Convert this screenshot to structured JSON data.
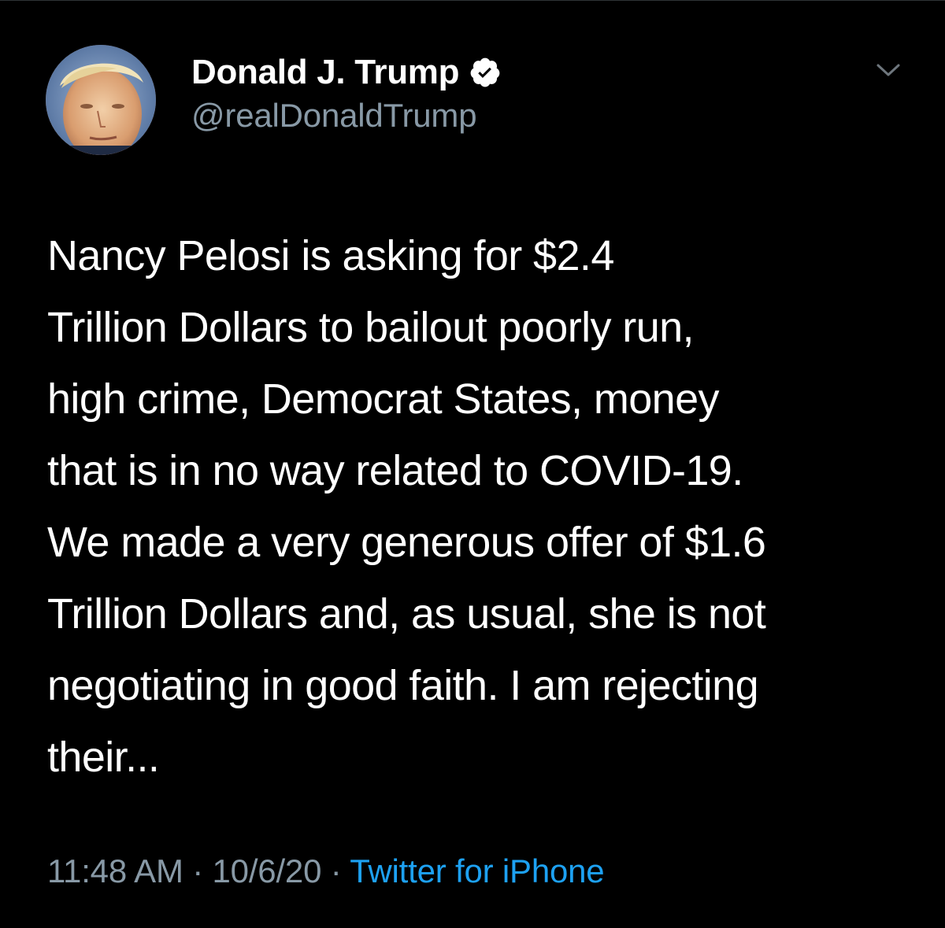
{
  "author": {
    "display_name": "Donald J. Trump",
    "handle": "@realDonaldTrump",
    "verified": true
  },
  "icons": {
    "verified": "verified-badge-icon",
    "menu": "chevron-down-icon",
    "avatar": "profile-photo"
  },
  "tweet": {
    "text": "Nancy Pelosi is asking for $2.4\nTrillion Dollars to bailout poorly run,\nhigh crime, Democrat States, money\nthat is in no way related to COVID-19.\nWe made a very generous offer of $1.6\nTrillion Dollars and, as usual, she is not\nnegotiating in good faith. I am rejecting\ntheir..."
  },
  "meta": {
    "time": "11:48 AM",
    "separator": "·",
    "date": "10/6/20",
    "source": "Twitter for iPhone"
  },
  "colors": {
    "background": "#000000",
    "text": "#ffffff",
    "secondary": "#8899a6",
    "link": "#1da1f2"
  }
}
